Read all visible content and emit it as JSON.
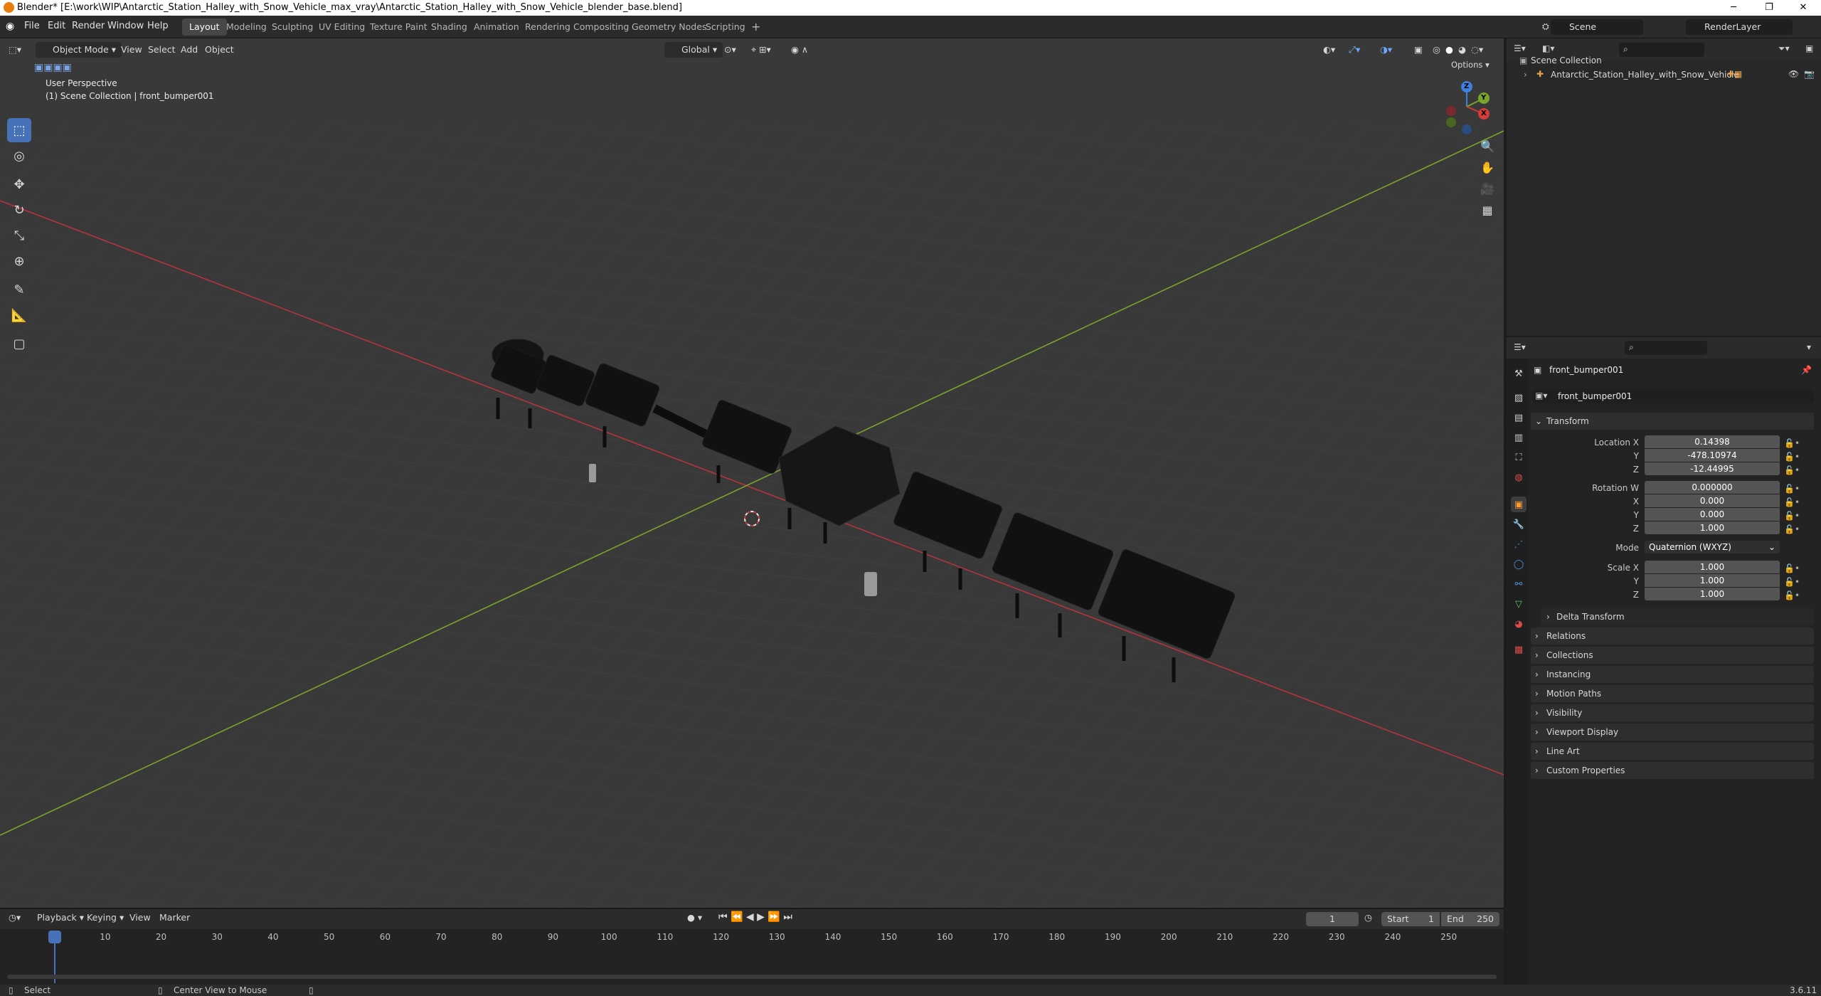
{
  "window": {
    "title": "Blender* [E:\\work\\WIP\\Antarctic_Station_Halley_with_Snow_Vehicle_max_vray\\Antarctic_Station_Halley_with_Snow_Vehicle_blender_base.blend]",
    "minimize": "─",
    "maximize": "❐",
    "close": "✕"
  },
  "menu": [
    "File",
    "Edit",
    "Render",
    "Window",
    "Help"
  ],
  "workspaces": [
    "Layout",
    "Modeling",
    "Sculpting",
    "UV Editing",
    "Texture Paint",
    "Shading",
    "Animation",
    "Rendering",
    "Compositing",
    "Geometry Nodes",
    "Scripting"
  ],
  "add_workspace": "+",
  "scene": {
    "name": "Scene",
    "render_layer": "RenderLayer"
  },
  "viewport": {
    "mode": "Object Mode",
    "menus": [
      "View",
      "Select",
      "Add",
      "Object"
    ],
    "orientation": "Global",
    "options": "Options",
    "overlay_title": "User Perspective",
    "overlay_collection": "(1) Scene Collection | front_bumper001",
    "gizmo": {
      "x": "X",
      "y": "Y",
      "z": "Z"
    }
  },
  "outliner": {
    "root": "Scene Collection",
    "items": [
      "Antarctic_Station_Halley_with_Snow_Vehicle"
    ]
  },
  "properties": {
    "object_name": "front_bumper001",
    "data_name": "front_bumper001",
    "transform_label": "Transform",
    "location_label": "Location X",
    "location": [
      "0.14398",
      "-478.10974",
      "-12.44995"
    ],
    "rotation_label": "Rotation W",
    "rotation": [
      "0.000000",
      "0.000",
      "0.000",
      "1.000"
    ],
    "mode_label": "Mode",
    "mode_value": "Quaternion (WXYZ)",
    "scale_label": "Scale X",
    "scale": [
      "1.000",
      "1.000",
      "1.000"
    ],
    "axis_y": "Y",
    "axis_z": "Z",
    "axis_x": "X",
    "delta": "Delta Transform",
    "panels": [
      "Relations",
      "Collections",
      "Instancing",
      "Motion Paths",
      "Visibility",
      "Viewport Display",
      "Line Art",
      "Custom Properties"
    ]
  },
  "timeline": {
    "menus": [
      "Playback",
      "Keying",
      "View",
      "Marker"
    ],
    "current_frame": "1",
    "start_label": "Start",
    "start": "1",
    "end_label": "End",
    "end": "250",
    "ticks": [
      "1",
      "10",
      "20",
      "30",
      "40",
      "50",
      "60",
      "70",
      "80",
      "90",
      "100",
      "110",
      "120",
      "130",
      "140",
      "150",
      "160",
      "170",
      "180",
      "190",
      "200",
      "210",
      "220",
      "230",
      "240",
      "250"
    ]
  },
  "status": {
    "select": "Select",
    "center": "Center View to Mouse",
    "version": "3.6.11"
  }
}
